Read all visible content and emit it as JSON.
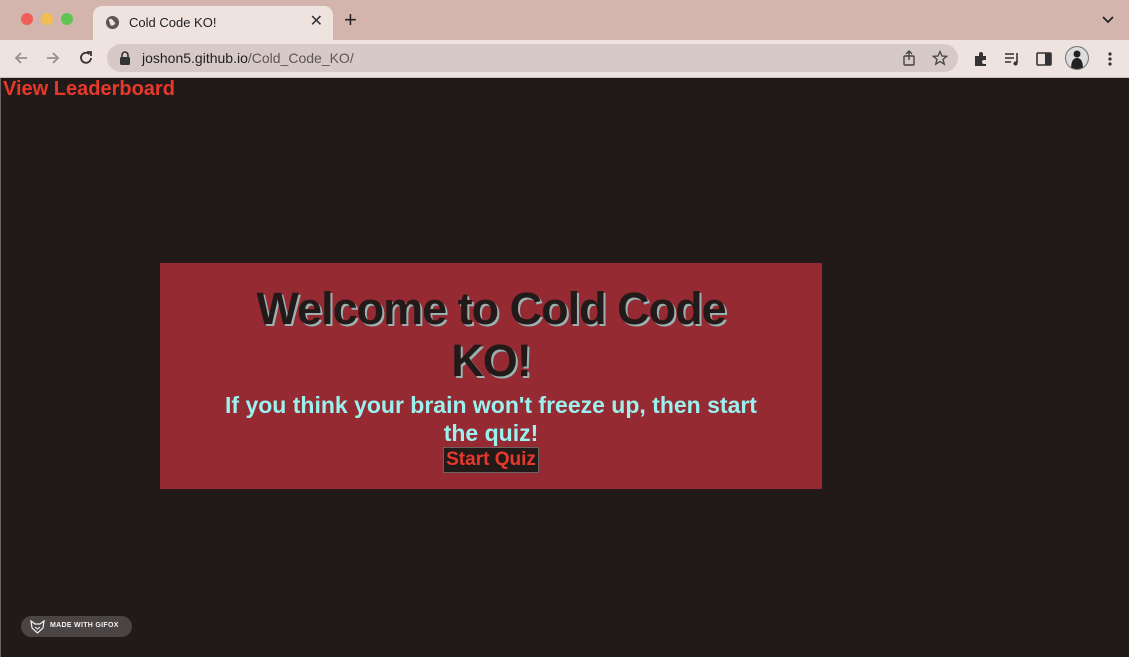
{
  "browser": {
    "tab_title": "Cold Code KO!",
    "tab_close": "✕",
    "new_tab": "+",
    "url_host": "joshon5.github.io",
    "url_path": "/Cold_Code_KO/",
    "icons": [
      "back-icon",
      "forward-icon",
      "reload-icon",
      "lock-icon",
      "share-icon",
      "bookmark-star-icon",
      "extensions-icon",
      "media-icon",
      "side-panel-icon",
      "profile-avatar",
      "menu-icon",
      "tab-list-chevron-icon",
      "globe-icon"
    ]
  },
  "page": {
    "leaderboard_link": "View Leaderboard",
    "card": {
      "title": "Welcome to Cold Code KO!",
      "subtitle": "If you think your brain won't freeze up, then start the quiz!",
      "start_button": "Start Quiz"
    },
    "watermark": "MADE WITH GIFOX",
    "colors": {
      "background": "#221a19",
      "card": "#962a33",
      "accent_red": "#e6392c",
      "subtitle_cyan": "#9bf1ee"
    }
  }
}
